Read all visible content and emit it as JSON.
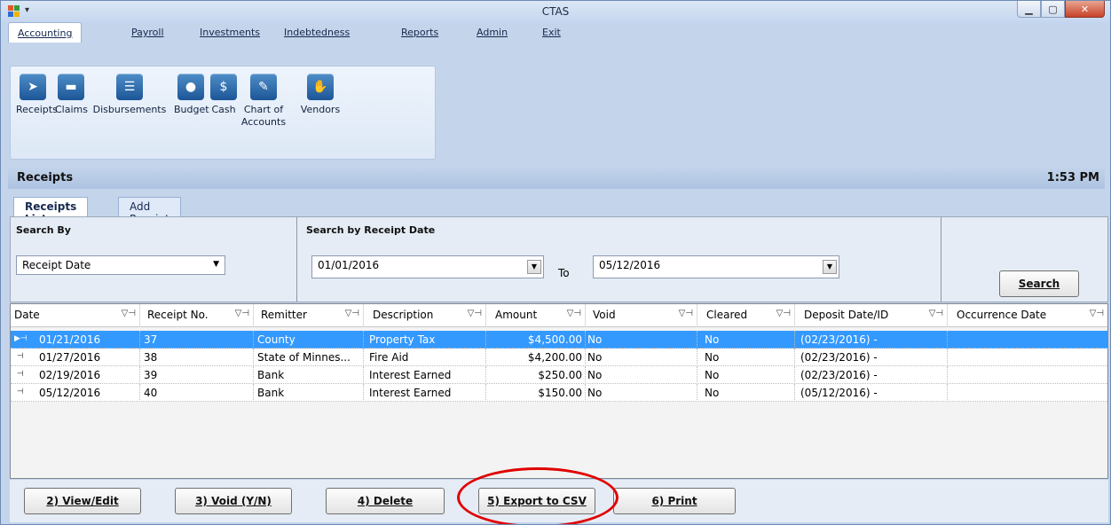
{
  "window": {
    "title": "CTAS"
  },
  "menu": [
    {
      "label": "Accounting",
      "active": true
    },
    {
      "label": "Payroll"
    },
    {
      "label": "Investments"
    },
    {
      "label": "Indebtedness"
    },
    {
      "label": "Reports"
    },
    {
      "label": "Admin"
    },
    {
      "label": "Exit"
    }
  ],
  "ribbon": [
    {
      "label": "Receipts",
      "icon": "receipts-icon"
    },
    {
      "label": "Claims",
      "icon": "claims-icon"
    },
    {
      "label": "Disbursements",
      "icon": "disbursements-icon"
    },
    {
      "label": "Budget",
      "icon": "budget-piggy-icon"
    },
    {
      "label": "Cash",
      "icon": "cash-icon"
    },
    {
      "label_line1": "Chart of",
      "label_line2": "Accounts",
      "icon": "chart-of-accounts-icon"
    },
    {
      "label": "Vendors",
      "icon": "vendors-handshake-icon"
    }
  ],
  "section": {
    "title": "Receipts",
    "time": "1:53 PM"
  },
  "tabs": [
    {
      "label": "Receipts List",
      "active": true
    },
    {
      "label": "Add Receipt"
    }
  ],
  "search": {
    "by_label": "Search By",
    "by_value": "Receipt Date",
    "date_label": "Search by Receipt Date",
    "from": "01/01/2016",
    "to_label": "To",
    "to": "05/12/2016",
    "button": "Search"
  },
  "grid": {
    "columns": [
      "Date",
      "Receipt No.",
      "Remitter",
      "Description",
      "Amount",
      "Void",
      "Cleared",
      "Deposit Date/ID",
      "Occurrence Date"
    ],
    "rows": [
      {
        "date": "01/21/2016",
        "receipt_no": "37",
        "remitter": "County",
        "description": "Property Tax",
        "amount": "$4,500.00",
        "void": "No",
        "cleared": "No",
        "deposit": "(02/23/2016) -",
        "occurrence": ""
      },
      {
        "date": "01/27/2016",
        "receipt_no": "38",
        "remitter": "State of Minnes...",
        "description": "Fire Aid",
        "amount": "$4,200.00",
        "void": "No",
        "cleared": "No",
        "deposit": "(02/23/2016) -",
        "occurrence": ""
      },
      {
        "date": "02/19/2016",
        "receipt_no": "39",
        "remitter": "Bank",
        "description": "Interest Earned",
        "amount": "$250.00",
        "void": "No",
        "cleared": "No",
        "deposit": "(02/23/2016) -",
        "occurrence": ""
      },
      {
        "date": "05/12/2016",
        "receipt_no": "40",
        "remitter": "Bank",
        "description": "Interest Earned",
        "amount": "$150.00",
        "void": "No",
        "cleared": "No",
        "deposit": "(05/12/2016) -",
        "occurrence": ""
      }
    ]
  },
  "actions": {
    "view_edit": "2) View/Edit",
    "void": "3) Void (Y/N)",
    "delete": "4) Delete",
    "export": "5) Export to CSV",
    "print": "6) Print"
  },
  "colors": {
    "selection": "#3399ff",
    "annotation": "#e00000",
    "ribbon_icon": "#1c5597"
  }
}
